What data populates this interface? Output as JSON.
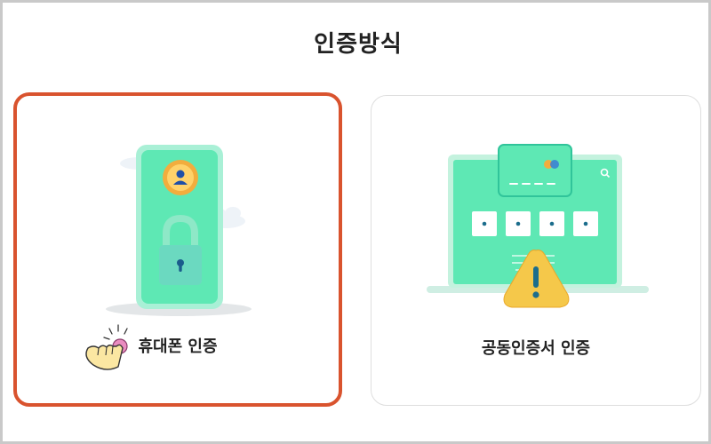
{
  "page": {
    "title": "인증방식"
  },
  "options": [
    {
      "label": "휴대폰 인증",
      "selected": true,
      "icon": "phone-lock-icon"
    },
    {
      "label": "공동인증서 인증",
      "selected": false,
      "icon": "certificate-laptop-icon"
    }
  ],
  "colors": {
    "accent_border": "#d9532e",
    "mint": "#5ee8b4",
    "text": "#222222"
  }
}
